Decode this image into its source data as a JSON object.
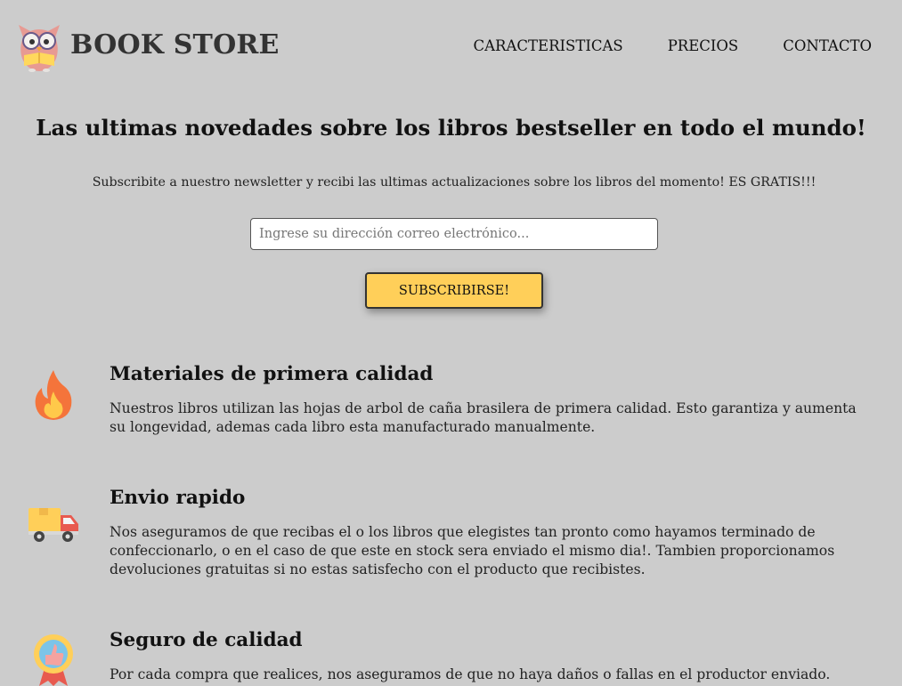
{
  "header": {
    "brand": "BOOK STORE",
    "nav": [
      {
        "label": "CARACTERISTICAS"
      },
      {
        "label": "PRECIOS"
      },
      {
        "label": "CONTACTO"
      }
    ]
  },
  "hero": {
    "title": "Las ultimas novedades sobre los libros bestseller en todo el mundo!",
    "subtitle": "Subscribite a nuestro newsletter y recibi las ultimas actualizaciones sobre los libros del momento! ES GRATIS!!!",
    "email_placeholder": "Ingrese su dirección correo electrónico...",
    "email_value": "",
    "button_label": "SUBSCRIBIRSE!"
  },
  "features": [
    {
      "icon": "fire-icon",
      "title": "Materiales de primera calidad",
      "text": "Nuestros libros utilizan las hojas de arbol de caña brasilera de primera calidad. Esto garantiza y aumenta su longevidad, ademas cada libro esta manufacturado manualmente."
    },
    {
      "icon": "truck-icon",
      "title": "Envio rapido",
      "text": "Nos aseguramos de que recibas el o los libros que elegistes tan pronto como hayamos terminado de confeccionarlo, o en el caso de que este en stock sera enviado el mismo dia!. Tambien proporcionamos devoluciones gratuitas si no estas satisfecho con el producto que recibistes."
    },
    {
      "icon": "quality-badge-icon",
      "title": "Seguro de calidad",
      "text": "Por cada compra que realices, nos aseguramos de que no haya daños o fallas en el productor enviado."
    }
  ],
  "colors": {
    "background": "#cccccc",
    "button": "#ffcf59",
    "fire": "#f4743b",
    "truck_body": "#ffcf59",
    "truck_cab": "#e85a4f"
  }
}
